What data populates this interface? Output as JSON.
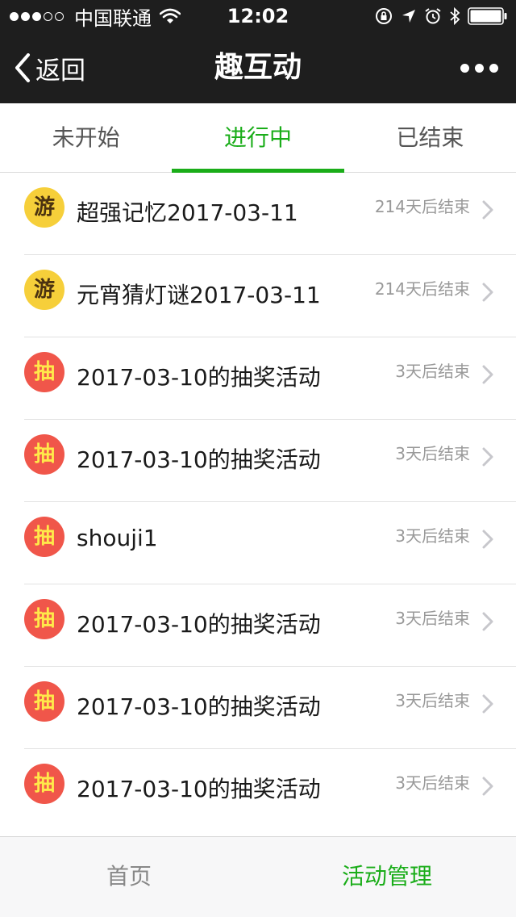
{
  "status_bar": {
    "carrier": "中国联通",
    "time": "12:02",
    "signal_bars_filled": 3,
    "signal_bars_total": 5
  },
  "nav": {
    "back_label": "返回",
    "title": "趣互动"
  },
  "tabs": [
    {
      "label": "未开始",
      "active": false
    },
    {
      "label": "进行中",
      "active": true
    },
    {
      "label": "已结束",
      "active": false
    }
  ],
  "items": [
    {
      "badge": "游",
      "badge_type": "game",
      "title": "超强记忆2017-03-11",
      "status": "214天后结束"
    },
    {
      "badge": "游",
      "badge_type": "game",
      "title": "元宵猜灯谜2017-03-11",
      "status": "214天后结束"
    },
    {
      "badge": "抽",
      "badge_type": "lottery",
      "title": "2017-03-10的抽奖活动",
      "status": "3天后结束"
    },
    {
      "badge": "抽",
      "badge_type": "lottery",
      "title": "2017-03-10的抽奖活动",
      "status": "3天后结束"
    },
    {
      "badge": "抽",
      "badge_type": "lottery",
      "title": "shouji1",
      "status": "3天后结束"
    },
    {
      "badge": "抽",
      "badge_type": "lottery",
      "title": "2017-03-10的抽奖活动",
      "status": "3天后结束"
    },
    {
      "badge": "抽",
      "badge_type": "lottery",
      "title": "2017-03-10的抽奖活动",
      "status": "3天后结束"
    },
    {
      "badge": "抽",
      "badge_type": "lottery",
      "title": "2017-03-10的抽奖活动",
      "status": "3天后结束"
    }
  ],
  "bottom_nav": [
    {
      "label": "首页",
      "active": false
    },
    {
      "label": "活动管理",
      "active": true
    }
  ],
  "colors": {
    "accent": "#1aad19",
    "nav_background": "#1e1e1e",
    "game_badge": "#f6cf3a",
    "lottery_badge": "#f0564a",
    "lottery_badge_text": "#ffe94a"
  },
  "icons": {
    "status_bar": [
      "wifi-icon",
      "rotation-lock-icon",
      "location-arrow-icon",
      "alarm-icon",
      "bluetooth-icon",
      "battery-icon"
    ],
    "nav": [
      "back-chevron-icon",
      "more-dots-icon"
    ],
    "row": "chevron-right-icon"
  }
}
